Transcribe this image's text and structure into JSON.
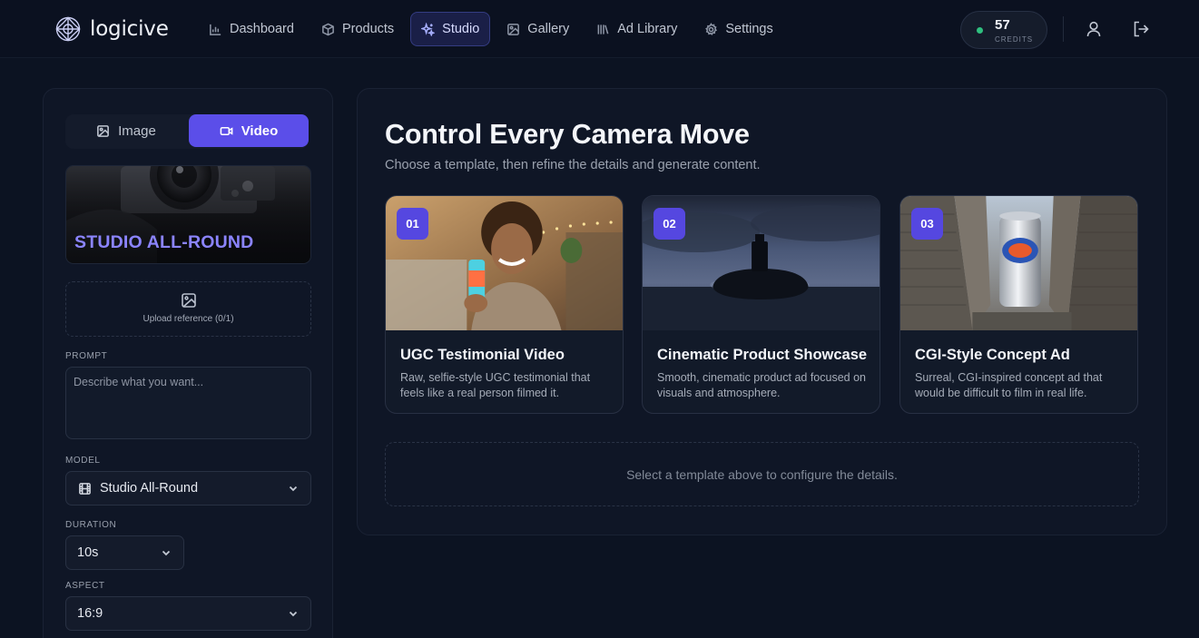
{
  "app": {
    "logo_text": "logicive"
  },
  "nav": [
    {
      "label": "Dashboard",
      "icon": "bar-chart-icon",
      "active": false
    },
    {
      "label": "Products",
      "icon": "box-icon",
      "active": false
    },
    {
      "label": "Studio",
      "icon": "sparkles-icon",
      "active": true
    },
    {
      "label": "Gallery",
      "icon": "image-icon",
      "active": false
    },
    {
      "label": "Ad Library",
      "icon": "library-icon",
      "active": false
    },
    {
      "label": "Settings",
      "icon": "gear-icon",
      "active": false
    }
  ],
  "credits": {
    "count": "57",
    "label": "CREDITS",
    "status_color": "#2fbf7f"
  },
  "sidebar": {
    "mode_tabs": {
      "image": "Image",
      "video": "Video",
      "selected": "Video"
    },
    "hero_title": "STUDIO ALL-ROUND",
    "upload_label": "Upload reference (0/1)",
    "prompt": {
      "label": "PROMPT",
      "placeholder": "Describe what you want...",
      "value": ""
    },
    "model": {
      "label": "MODEL",
      "value": "Studio All-Round"
    },
    "duration": {
      "label": "DURATION",
      "value": "10s"
    },
    "aspect": {
      "label": "ASPECT",
      "value": "16:9"
    }
  },
  "main": {
    "title": "Control Every Camera Move",
    "subtitle": "Choose a template, then refine the details and generate content.",
    "templates": [
      {
        "number": "01",
        "title": "UGC Testimonial Video",
        "description": "Raw, selfie-style UGC testimonial that feels like a real person filmed it."
      },
      {
        "number": "02",
        "title": "Cinematic Product Showcase",
        "description": "Smooth, cinematic product ad focused on visuals and atmosphere."
      },
      {
        "number": "03",
        "title": "CGI-Style Concept Ad",
        "description": "Surreal, CGI-inspired concept ad that would be difficult to film in real life."
      }
    ],
    "empty_state": "Select a template above to configure the details."
  },
  "colors": {
    "accent": "#5b4ee9",
    "badge": "#5547e0",
    "hero_title": "#8b84ff",
    "background": "#0c1322"
  }
}
